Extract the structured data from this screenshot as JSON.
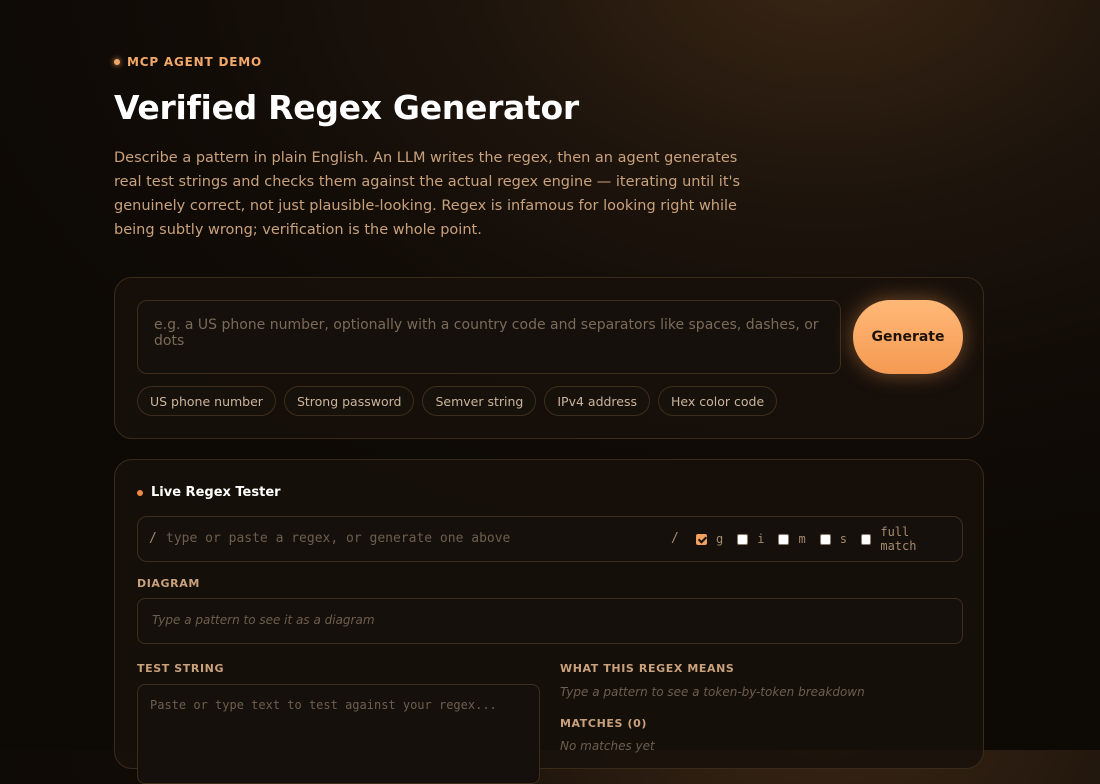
{
  "header": {
    "eyebrow": "MCP AGENT DEMO",
    "title": "Verified Regex Generator",
    "description": "Describe a pattern in plain English. An LLM writes the regex, then an agent generates real test strings and checks them against the actual regex engine — iterating until it's genuinely correct, not just plausible-looking. Regex is infamous for looking right while being subtly wrong; verification is the whole point."
  },
  "generator": {
    "placeholder": "e.g. a US phone number, optionally with a country code and separators like spaces, dashes, or dots",
    "button_label": "Generate",
    "examples": [
      "US phone number",
      "Strong password",
      "Semver string",
      "IPv4 address",
      "Hex color code"
    ]
  },
  "tester": {
    "title": "Live Regex Tester",
    "slash": "/",
    "regex_placeholder": "type or paste a regex, or generate one above",
    "flags": [
      {
        "label": "g",
        "checked": true
      },
      {
        "label": "i",
        "checked": false
      },
      {
        "label": "m",
        "checked": false
      },
      {
        "label": "s",
        "checked": false
      },
      {
        "label": "full match",
        "checked": false
      }
    ],
    "diagram_label": "DIAGRAM",
    "diagram_hint": "Type a pattern to see it as a diagram",
    "test_label": "TEST STRING",
    "test_placeholder": "Paste or type text to test against your regex...",
    "meaning_label": "WHAT THIS REGEX MEANS",
    "meaning_hint": "Type a pattern to see a token-by-token breakdown",
    "matches_label": "MATCHES (0)",
    "matches_hint": "No matches yet"
  },
  "colors": {
    "accent": "#f59a52",
    "background": "#120c07"
  }
}
